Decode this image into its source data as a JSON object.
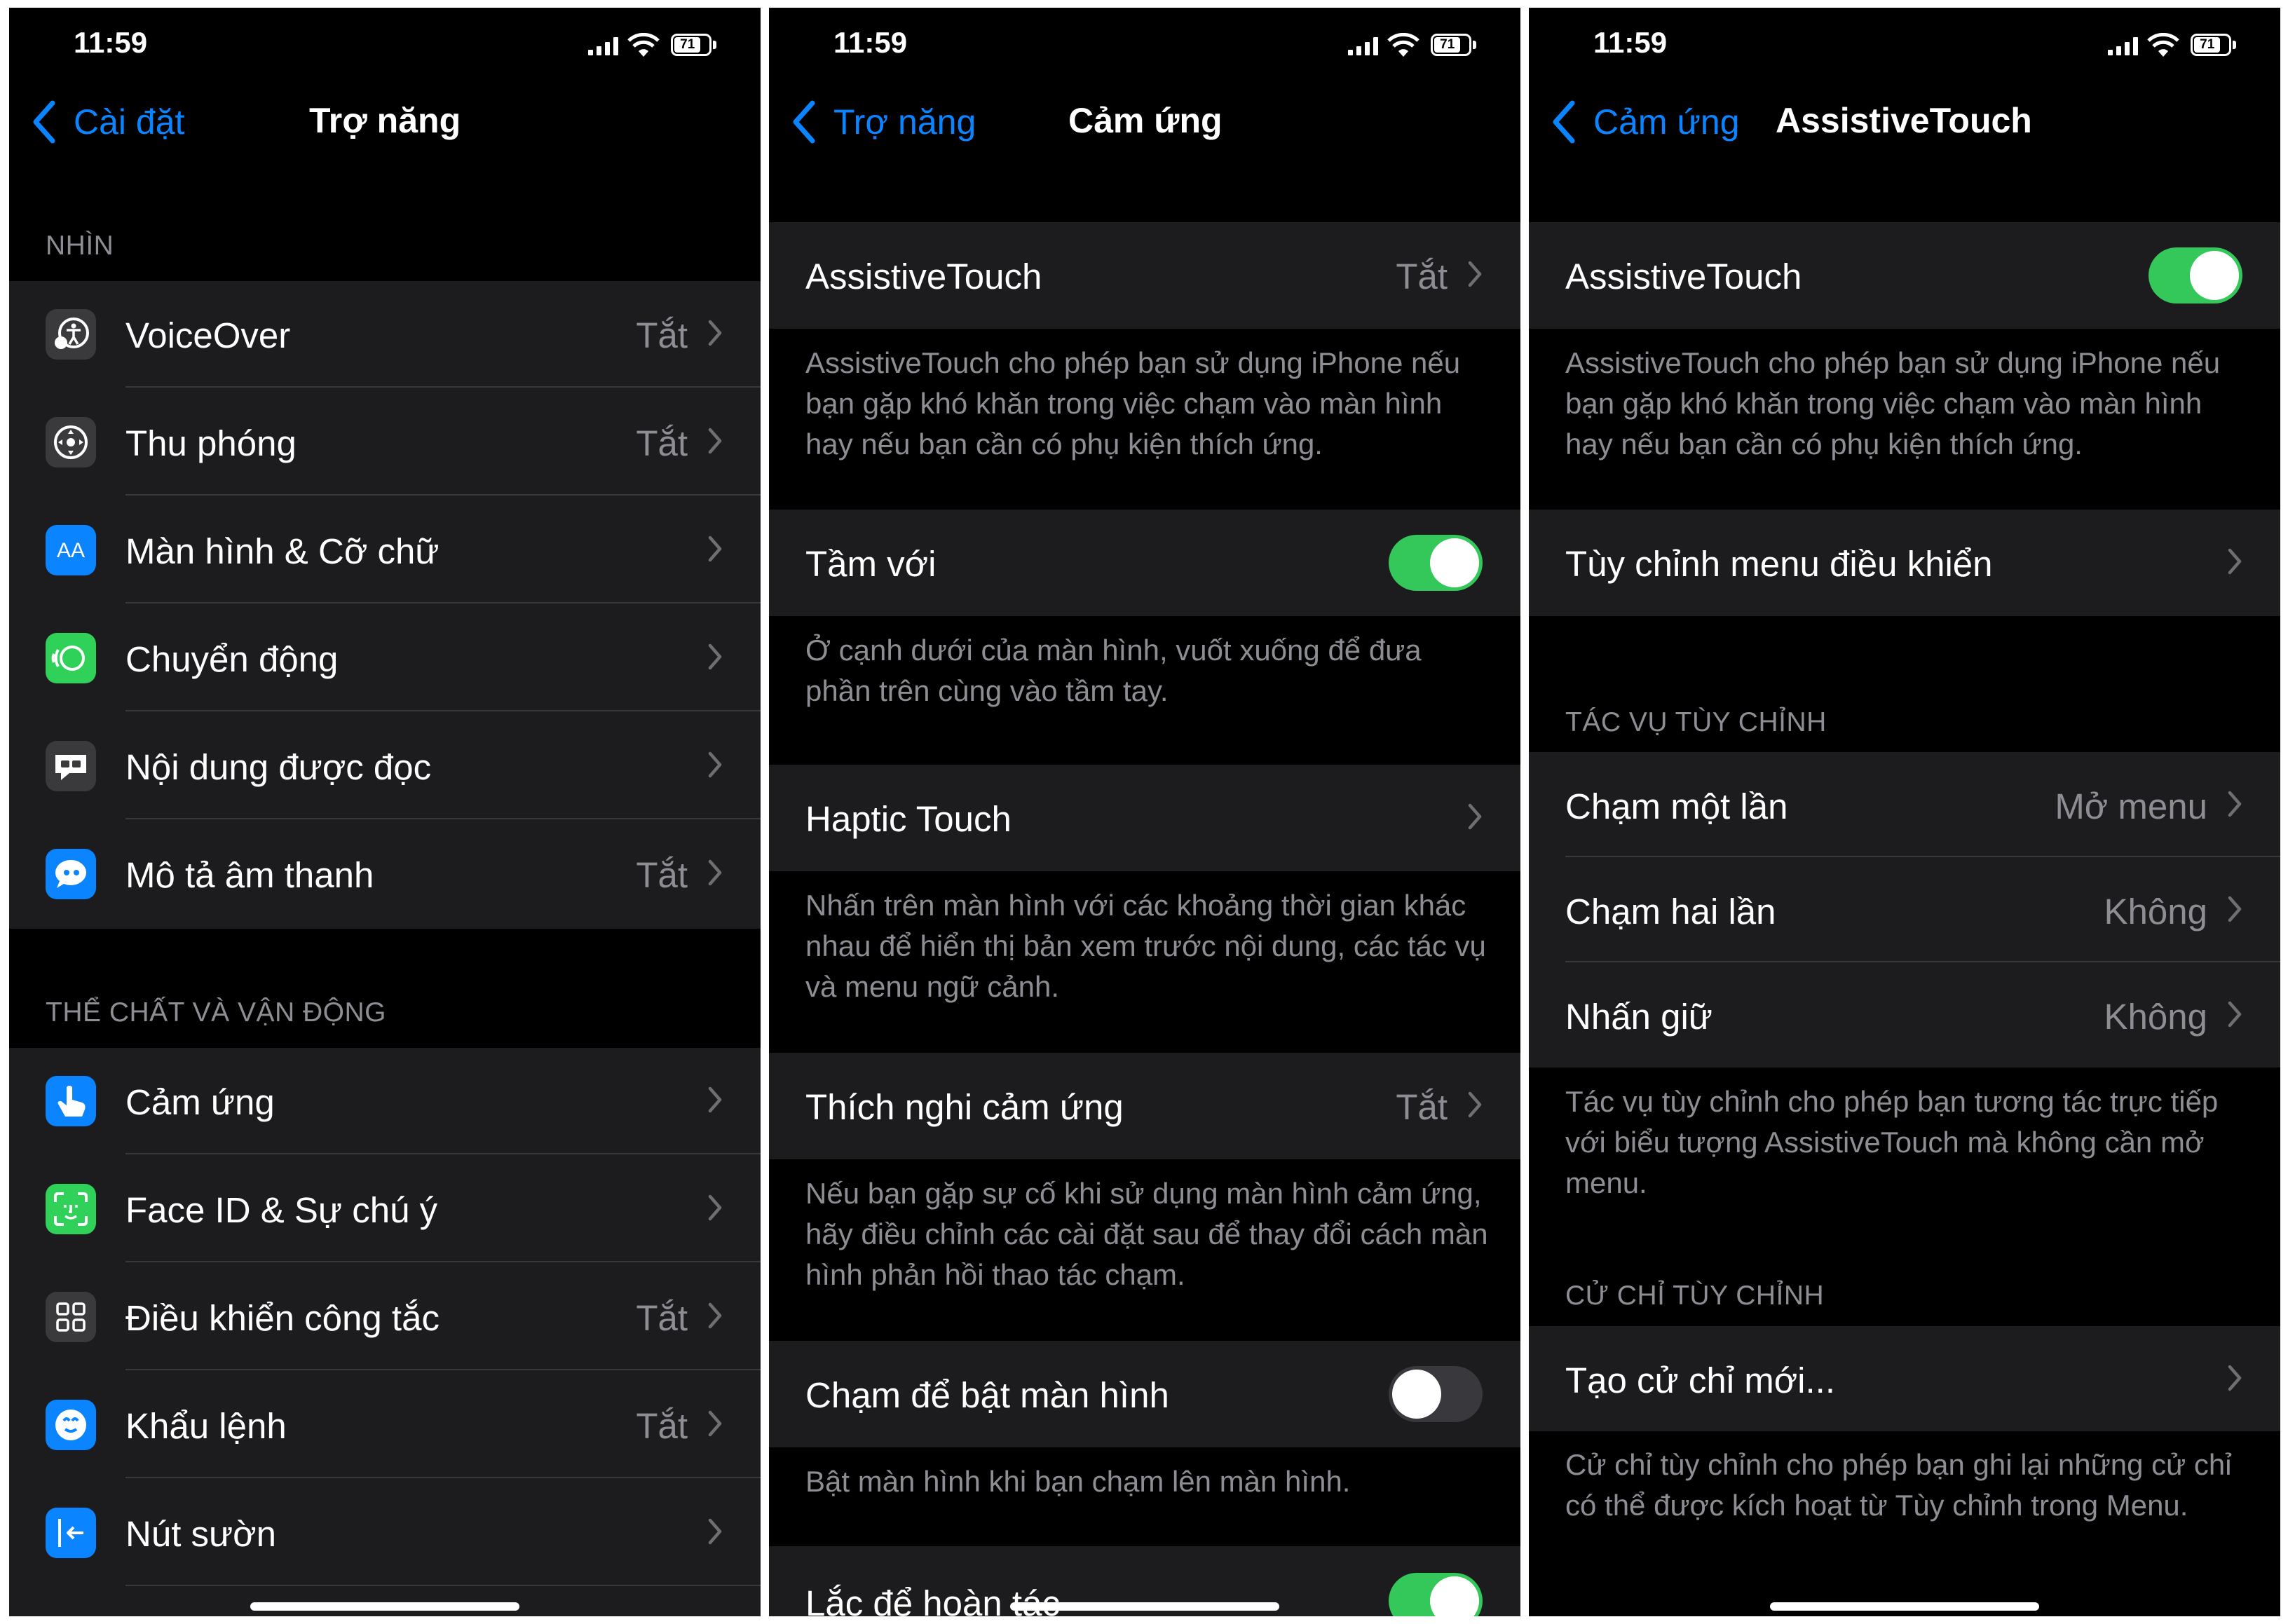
{
  "status": {
    "time": "11:59",
    "battery": "71"
  },
  "colors": {
    "accent": "#0a84ff",
    "toggle_on": "#34c759",
    "row_bg": "#1c1c1e",
    "secondary_text": "#8d8d93"
  },
  "screen1": {
    "back_label": "Cài đặt",
    "title": "Trợ năng",
    "section_vision": "NHÌN",
    "vision_items": [
      {
        "label": "VoiceOver",
        "value": "Tắt",
        "icon": "voiceover-icon"
      },
      {
        "label": "Thu phóng",
        "value": "Tắt",
        "icon": "zoom-icon"
      },
      {
        "label": "Màn hình & Cỡ chữ",
        "value": "",
        "icon": "text-size-icon"
      },
      {
        "label": "Chuyển động",
        "value": "",
        "icon": "motion-icon"
      },
      {
        "label": "Nội dung được đọc",
        "value": "",
        "icon": "spoken-content-icon"
      },
      {
        "label": "Mô tả âm thanh",
        "value": "Tắt",
        "icon": "audio-description-icon"
      }
    ],
    "section_physical": "THỂ CHẤT VÀ VẬN ĐỘNG",
    "physical_items": [
      {
        "label": "Cảm ứng",
        "value": "",
        "icon": "touch-icon"
      },
      {
        "label": "Face ID & Sự chú ý",
        "value": "",
        "icon": "face-id-icon"
      },
      {
        "label": "Điều khiển công tắc",
        "value": "Tắt",
        "icon": "switch-control-icon"
      },
      {
        "label": "Khẩu lệnh",
        "value": "Tắt",
        "icon": "voice-control-icon"
      },
      {
        "label": "Nút sườn",
        "value": "",
        "icon": "side-button-icon"
      }
    ]
  },
  "screen2": {
    "back_label": "Trợ năng",
    "title": "Cảm ứng",
    "assistivetouch": {
      "label": "AssistiveTouch",
      "value": "Tắt"
    },
    "assistivetouch_note": "AssistiveTouch cho phép bạn sử dụng iPhone nếu bạn gặp khó khăn trong việc chạm vào màn hình hay nếu bạn cần có phụ kiện thích ứng.",
    "reachability": {
      "label": "Tầm với",
      "enabled": true
    },
    "reachability_note": "Ở cạnh dưới của màn hình, vuốt xuống để đưa phần trên cùng vào tầm tay.",
    "haptic": {
      "label": "Haptic Touch"
    },
    "haptic_note": "Nhấn trên màn hình với các khoảng thời gian khác nhau để hiển thị bản xem trước nội dung, các tác vụ và menu ngữ cảnh.",
    "touch_accommodations": {
      "label": "Thích nghi cảm ứng",
      "value": "Tắt"
    },
    "touch_accommodations_note": "Nếu bạn gặp sự cố khi sử dụng màn hình cảm ứng, hãy điều chỉnh các cài đặt sau để thay đổi cách màn hình phản hồi thao tác chạm.",
    "tap_to_wake": {
      "label": "Chạm để bật màn hình",
      "enabled": false
    },
    "tap_to_wake_note": "Bật màn hình khi bạn chạm lên màn hình.",
    "shake_to_undo": {
      "label": "Lắc để hoàn tác",
      "enabled": true
    }
  },
  "screen3": {
    "back_label": "Cảm ứng",
    "title": "AssistiveTouch",
    "assistivetouch": {
      "label": "AssistiveTouch",
      "enabled": true
    },
    "assistivetouch_note": "AssistiveTouch cho phép bạn sử dụng iPhone nếu bạn gặp khó khăn trong việc chạm vào màn hình hay nếu bạn cần có phụ kiện thích ứng.",
    "customize_menu": {
      "label": "Tùy chỉnh menu điều khiển"
    },
    "section_custom_actions": "TÁC VỤ TÙY CHỈNH",
    "custom_actions": [
      {
        "label": "Chạm một lần",
        "value": "Mở menu"
      },
      {
        "label": "Chạm hai lần",
        "value": "Không"
      },
      {
        "label": "Nhấn giữ",
        "value": "Không"
      }
    ],
    "custom_actions_note": "Tác vụ tùy chỉnh cho phép bạn tương tác trực tiếp với biểu tượng AssistiveTouch mà không cần mở menu.",
    "section_custom_gestures": "CỬ CHỈ TÙY CHỈNH",
    "create_gesture": {
      "label": "Tạo cử chỉ mới..."
    },
    "custom_gestures_note": "Cử chỉ tùy chỉnh cho phép bạn ghi lại những cử chỉ có thể được kích hoạt từ Tùy chỉnh trong Menu."
  }
}
